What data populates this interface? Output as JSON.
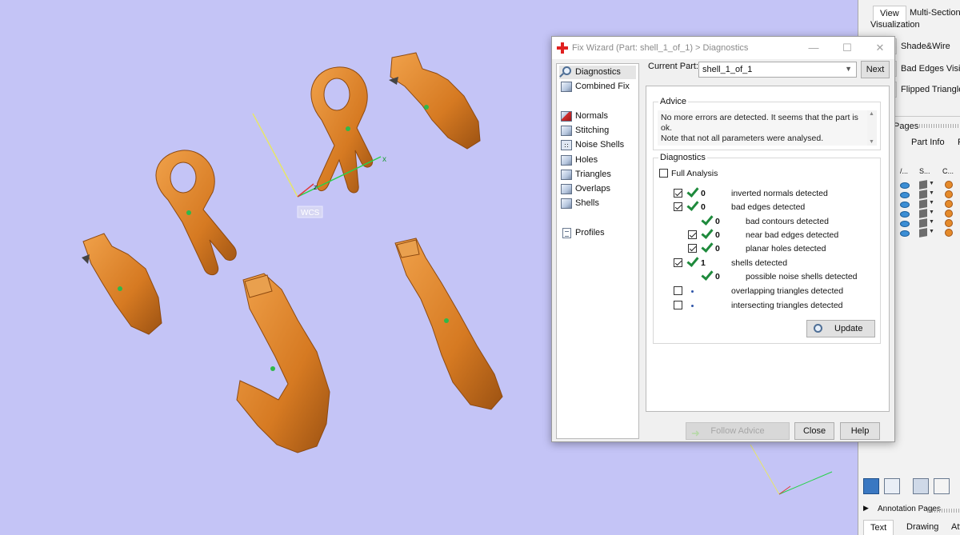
{
  "viewport": {
    "axis_label": "WCS",
    "axis_x_label": "x",
    "axis_z_label": "z",
    "part_color": "#d9822b",
    "background_color": "#c4c4f6"
  },
  "side_panel": {
    "tabs": [
      "View",
      "Multi-Section"
    ],
    "visualization_label": "Visualization",
    "buttons": [
      "Shade&Wire",
      "Bad Edges Visible",
      "Flipped Triangles V"
    ],
    "pages_label": "Pages",
    "sub_tabs": [
      "Part Info",
      "F"
    ],
    "columns": [
      "/...",
      "S...",
      "C..."
    ],
    "row_count": 6,
    "annotation_label": "Annotation Pages",
    "bottom_tabs": [
      "Text",
      "Drawing",
      "Att"
    ]
  },
  "fix_wizard": {
    "title": "Fix Wizard (Part: shell_1_of_1) > Diagnostics",
    "nav": [
      {
        "label": "Diagnostics",
        "icon": "magnifier-icon",
        "selected": true
      },
      {
        "label": "Combined Fix",
        "icon": "cube-icon"
      },
      {
        "label": "Normals",
        "icon": "normals-cube-icon"
      },
      {
        "label": "Stitching",
        "icon": "cube-icon"
      },
      {
        "label": "Noise Shells",
        "icon": "noise-cube-icon"
      },
      {
        "label": "Holes",
        "icon": "cube-icon"
      },
      {
        "label": "Triangles",
        "icon": "cube-icon"
      },
      {
        "label": "Overlaps",
        "icon": "cube-icon"
      },
      {
        "label": "Shells",
        "icon": "cube-icon"
      },
      {
        "label": "Profiles",
        "icon": "document-icon"
      }
    ],
    "current_part_label": "Current Part:",
    "current_part_value": "shell_1_of_1",
    "next_button": "Next",
    "advice_title": "Advice",
    "advice_text": "No more errors are detected. It seems that the part is ok.\nNote that not all parameters were analysed.",
    "diagnostics_title": "Diagnostics",
    "full_analysis_label": "Full Analysis",
    "rows": [
      {
        "count": "0",
        "label": "inverted normals detected",
        "checkbox": true,
        "checked": true,
        "status": "ok",
        "indent": 0
      },
      {
        "count": "0",
        "label": "bad edges detected",
        "checkbox": true,
        "checked": true,
        "status": "ok",
        "indent": 0
      },
      {
        "count": "0",
        "label": "bad contours detected",
        "checkbox": false,
        "checked": false,
        "status": "ok",
        "indent": 1
      },
      {
        "count": "0",
        "label": "near bad edges detected",
        "checkbox": true,
        "checked": true,
        "status": "ok",
        "indent": 1
      },
      {
        "count": "0",
        "label": "planar holes detected",
        "checkbox": true,
        "checked": true,
        "status": "ok",
        "indent": 1
      },
      {
        "count": "1",
        "label": "shells detected",
        "checkbox": true,
        "checked": true,
        "status": "ok",
        "indent": 0
      },
      {
        "count": "0",
        "label": "possible noise shells detected",
        "checkbox": false,
        "checked": false,
        "status": "ok",
        "indent": 1
      },
      {
        "count": "",
        "label": "overlapping triangles detected",
        "checkbox": true,
        "checked": false,
        "status": "not-run",
        "indent": 0
      },
      {
        "count": "",
        "label": "intersecting triangles detected",
        "checkbox": true,
        "checked": false,
        "status": "not-run",
        "indent": 0
      }
    ],
    "update_button": "Update",
    "follow_advice_button": "Follow Advice",
    "close_button": "Close",
    "help_button": "Help",
    "status_ok_color": "#1e8a3c"
  }
}
